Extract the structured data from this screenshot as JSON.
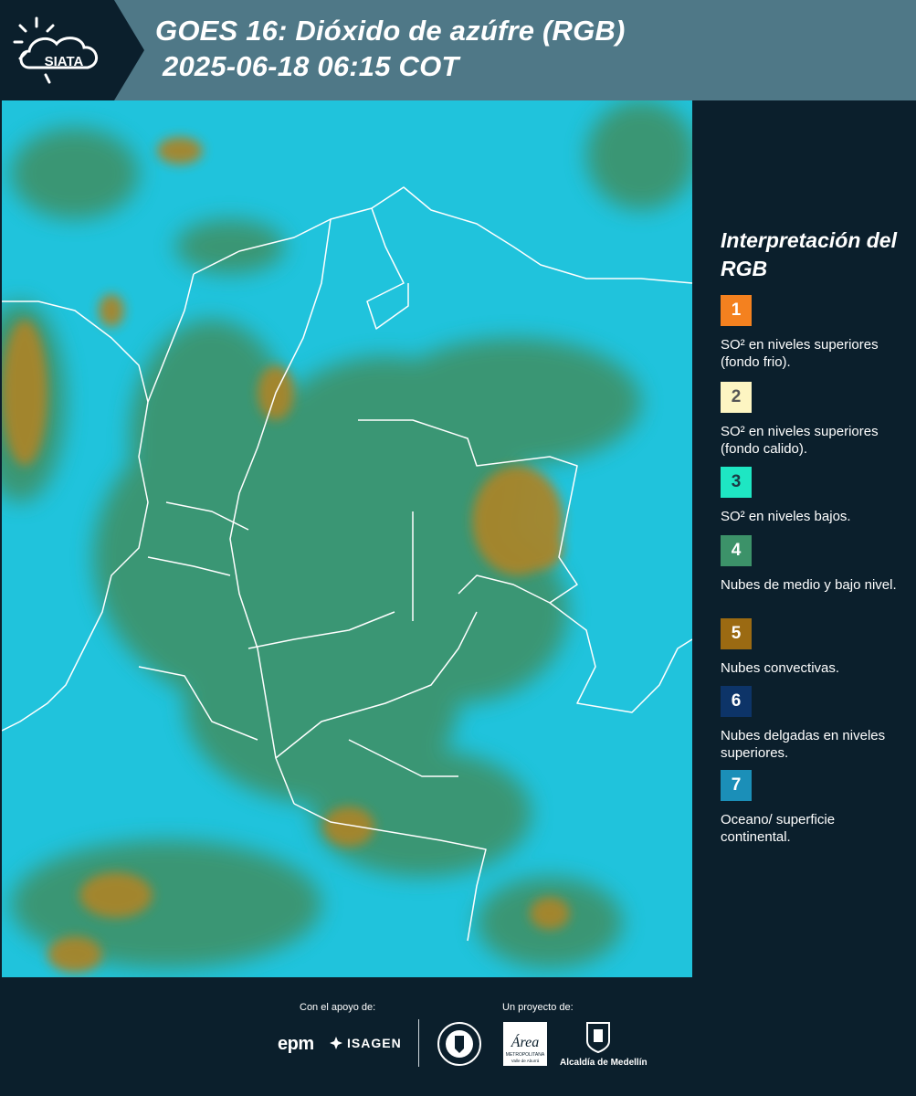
{
  "header": {
    "logo_text": "SIATA",
    "title_line_1": "GOES 16: Dióxido de azúfre (RGB)",
    "title_line_2": "2025-06-18 06:15 COT"
  },
  "legend": {
    "title": "Interpretación del RGB",
    "items": [
      {
        "number": "1",
        "color": "#f4811f",
        "text_color": "#ffffff",
        "description": "SO² en niveles superiores (fondo frio)."
      },
      {
        "number": "2",
        "color": "#fdf5c2",
        "text_color": "#555555",
        "description": "SO² en niveles superiores (fondo calido)."
      },
      {
        "number": "3",
        "color": "#1ee6c3",
        "text_color": "#1b3a44",
        "description": "SO² en niveles bajos."
      },
      {
        "number": "4",
        "color": "#3c9269",
        "text_color": "#ffffff",
        "description": "Nubes de medio y bajo nivel."
      },
      {
        "number": "5",
        "color": "#9b6a12",
        "text_color": "#ffffff",
        "description": "Nubes convectivas."
      },
      {
        "number": "6",
        "color": "#0d3468",
        "text_color": "#ffffff",
        "description": "Nubes delgadas en niveles superiores."
      },
      {
        "number": "7",
        "color": "#1b8fb8",
        "text_color": "#ffffff",
        "description": "Oceano/ superficie continental."
      }
    ]
  },
  "map": {
    "ocean_color": "#20c3dc",
    "low_cloud_color": "#3c9269",
    "convective_color": "#a8852a",
    "border_color": "#ffffff"
  },
  "footer": {
    "support_label": "Con el apoyo de:",
    "project_label": "Un proyecto de:",
    "epm": "epm",
    "isagen": "ISAGEN",
    "area_name": "Área",
    "area_subtitle": "METROPOLITANA",
    "area_subtitle_2": "Valle de Aburrá",
    "alcaldia": "Alcaldía de Medellín"
  }
}
